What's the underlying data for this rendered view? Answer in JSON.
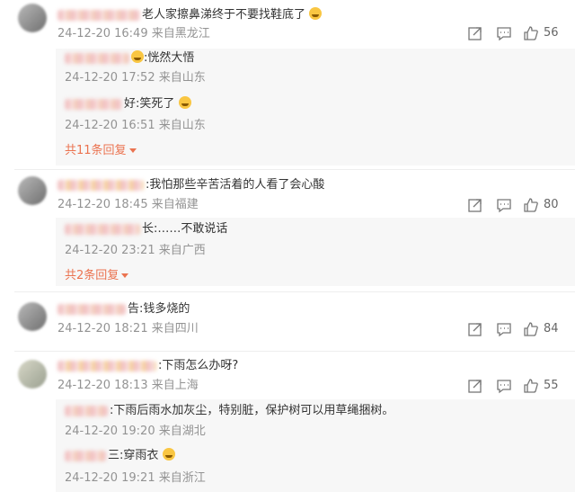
{
  "comments": [
    {
      "text": "老人家擦鼻涕终于不要找鞋底了",
      "time": "24-12-20 16:49",
      "location": "来自黑龙江",
      "likes": "56",
      "replies": [
        {
          "text": ":恍然大悟",
          "time": "24-12-20 17:52",
          "location": "来自山东"
        },
        {
          "text": "好:笑死了",
          "time": "24-12-20 16:51",
          "location": "来自山东"
        }
      ],
      "more": "共11条回复"
    },
    {
      "text": ":我怕那些辛苦活着的人看了会心酸",
      "time": "24-12-20 18:45",
      "location": "来自福建",
      "likes": "80",
      "replies": [
        {
          "text": "长:……不敢说话",
          "time": "24-12-20 23:21",
          "location": "来自广西"
        }
      ],
      "more": "共2条回复"
    },
    {
      "text": "告:钱多烧的",
      "time": "24-12-20 18:21",
      "location": "来自四川",
      "likes": "84",
      "replies": []
    },
    {
      "text": ":下雨怎么办呀?",
      "time": "24-12-20 18:13",
      "location": "来自上海",
      "likes": "55",
      "replies": [
        {
          "text": ":下雨后雨水加灰尘，特别脏，保护树可以用草绳捆树。",
          "time": "24-12-20 19:20",
          "location": "来自湖北"
        },
        {
          "text": "三:穿雨衣",
          "time": "24-12-20 19:21",
          "location": "来自浙江"
        }
      ]
    }
  ],
  "icons": {
    "share": "share-icon",
    "comment": "comment-icon",
    "like": "thumbs-up-icon",
    "emoji": "emoji-icon"
  },
  "colors": {
    "more": "#eb7350",
    "meta": "#939393"
  }
}
